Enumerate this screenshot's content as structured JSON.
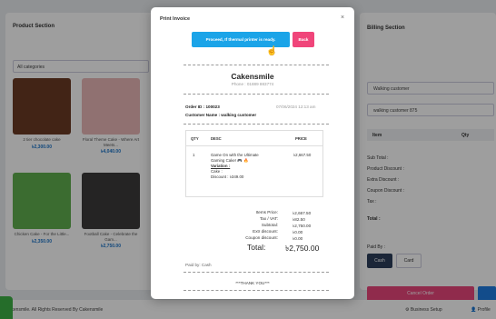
{
  "background": {
    "product_section": {
      "title": "Product Section",
      "category_select": "All categories",
      "products": [
        {
          "name": "2 tier chocolate cake",
          "price": "৳2,300.00",
          "color": "#6b3a24"
        },
        {
          "name": "Floral Theme Cake - Where Art Meets...",
          "price": "৳4,040.00",
          "color": "#e9b7b7"
        },
        {
          "name": "Chicken Cake - For the Little...",
          "price": "৳2,350.00",
          "color": "#5fae4d"
        },
        {
          "name": "Football Cake - Celebrate the Gam...",
          "price": "৳2,750.00",
          "color": "#3b3a3a"
        }
      ]
    },
    "billing_section": {
      "title": "Billing Section",
      "customer_field": "Walking customer",
      "customer_id_field": "walking customer 875",
      "col_item": "Item",
      "col_qty": "Qty",
      "sub_total": "Sub Total :",
      "product_discount": "Product Discount :",
      "extra_discount": "Extra Discount :",
      "coupon_discount": "Coupon Discount :",
      "tax": "Tax :",
      "total": "Total :",
      "paid_by": "Paid By :",
      "cash": "Cash",
      "card": "Card",
      "cancel_order": "Cancel Order"
    },
    "footer": {
      "copyright": "Cakensmile. All Rights Reserved By Cakensmile",
      "business_setup": "Business Setup",
      "profile": "Profile"
    }
  },
  "modal": {
    "title": "Print Invoice",
    "close": "×",
    "proceed_button": "Proceed, If thermal printer is ready.",
    "back_button": "Back",
    "receipt": {
      "shop_name": "Cakensmile",
      "phone": "Phone : 01889 883774",
      "order_id": "Order ID : 100023",
      "date": "07/06/2024 12:13 am",
      "customer": "Customer Name : walking customer",
      "col_qty": "QTY",
      "col_desc": "DESC",
      "col_price": "PRICE",
      "item_qty": "1",
      "item_desc_1": "Game On with the Ultimate",
      "item_desc_2": "Gaming Cake! 🎮 🔥",
      "variation_label": "Variation :",
      "variation_value": "Cake :",
      "discount": "Discount : ৳349.00",
      "item_price": "৳2,667.50",
      "items_price_label": "Items Price:",
      "items_price": "৳2,667.50",
      "tax_label": "Tax / VAT:",
      "tax": "৳82.50",
      "subtotal_label": "Subtotal:",
      "subtotal": "৳2,750.00",
      "extra_discount_label": "Extr discount:",
      "extra_discount": "৳0.00",
      "coupon_discount_label": "Coupon discount:",
      "coupon_discount": "৳0.00",
      "total_label": "Total:",
      "total": "৳2,750.00",
      "paid_by": "Paid by: Cash",
      "thanks": "***THANK YOU***"
    }
  },
  "colors": {
    "proceed": "#1ba4e8",
    "back": "#f0457a",
    "cancel": "#e8457a",
    "cash": "#2c3e5a",
    "price": "#1a73c8"
  }
}
